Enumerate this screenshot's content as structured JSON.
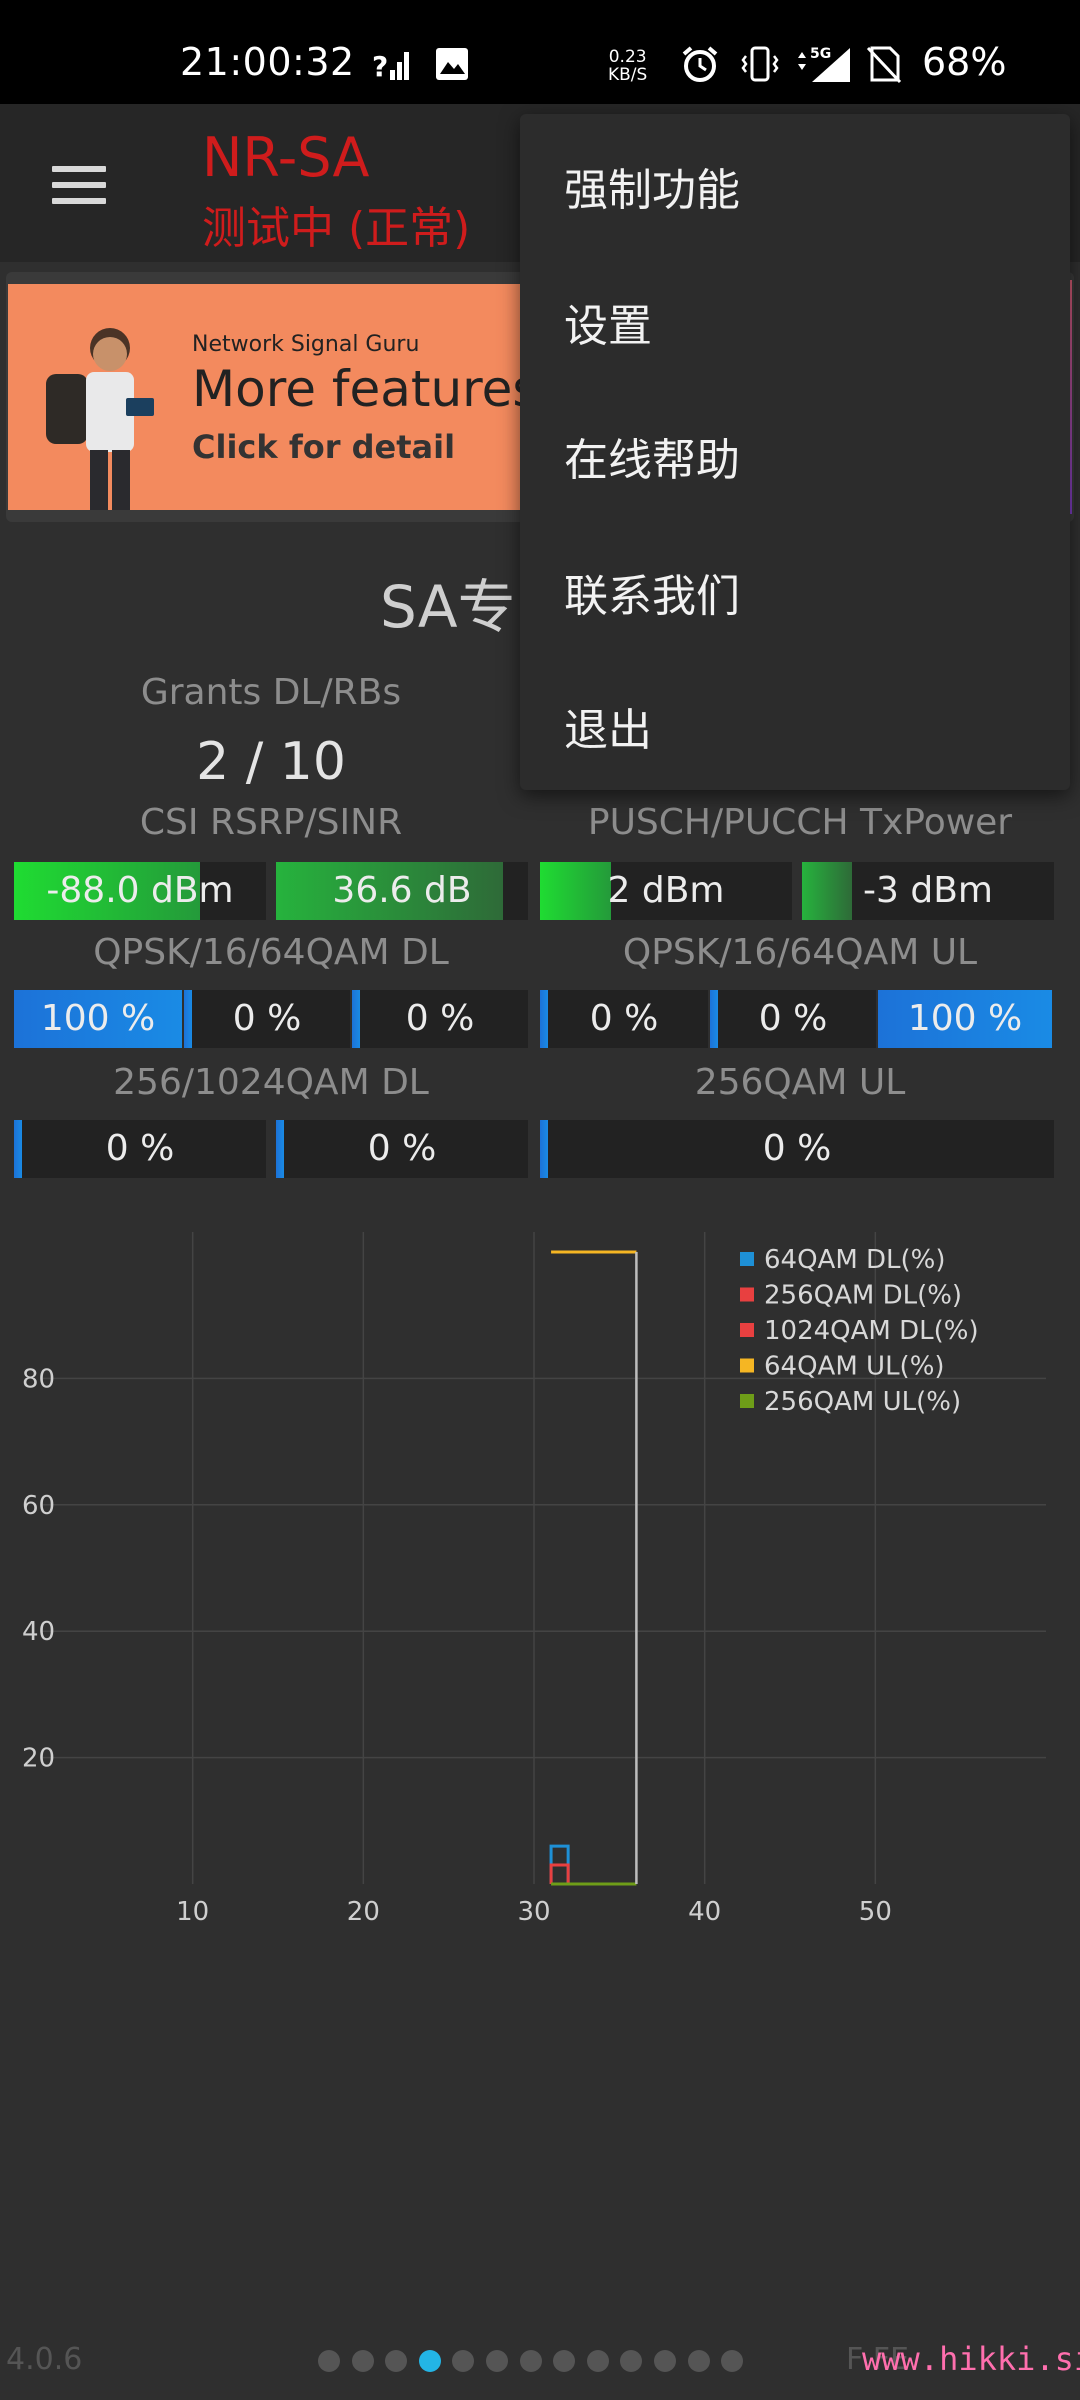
{
  "status_bar": {
    "time": "21:00:32",
    "speed_value": "0.23",
    "speed_unit": "KB/S",
    "network_badge": "5G",
    "battery": "68%",
    "icons": [
      "signal-question-icon",
      "image-icon",
      "alarm-icon",
      "vibrate-icon",
      "5g-signal-icon",
      "no-sim-icon"
    ]
  },
  "app_bar": {
    "title": "NR-SA",
    "subtitle": "测试中 (正常)"
  },
  "banner": {
    "small": "Network Signal Guru",
    "big": "More features f",
    "link": "Click for detail"
  },
  "section": {
    "title": "SA专",
    "grants_label": "Grants DL/RBs",
    "grants_value": "2 / 10",
    "csi_label": "CSI RSRP/SINR",
    "pusch_label": "PUSCH/PUCCH TxPower",
    "qam_dl_label": "QPSK/16/64QAM DL",
    "qam_ul_label": "QPSK/16/64QAM UL",
    "qam256_dl_label": "256/1024QAM DL",
    "qam256_ul_label": "256QAM UL"
  },
  "bars": {
    "csi_rsrp": {
      "text": "-88.0 dBm",
      "level": 0.74
    },
    "csi_sinr": {
      "text": "36.6 dB",
      "level": 0.9
    },
    "pusch_power": {
      "text": "2 dBm",
      "level": 0.28
    },
    "pucch_power": {
      "text": "-3 dBm",
      "level": 0.2
    },
    "dl_qpsk": {
      "text": "100 %",
      "level": 1.0
    },
    "dl_16qam": {
      "text": "0 %",
      "level": 0
    },
    "dl_64qam": {
      "text": "0 %",
      "level": 0
    },
    "ul_qpsk": {
      "text": "0 %",
      "level": 0
    },
    "ul_16qam": {
      "text": "0 %",
      "level": 0
    },
    "ul_64qam": {
      "text": "100 %",
      "level": 1.0
    },
    "dl_256qam": {
      "text": "0 %",
      "level": 0
    },
    "dl_1024qam": {
      "text": "0 %",
      "level": 0
    },
    "ul_256qam": {
      "text": "0 %",
      "level": 0
    }
  },
  "chart_data": {
    "type": "line",
    "x_ticks": [
      10,
      20,
      30,
      40,
      50
    ],
    "y_ticks": [
      20,
      40,
      60,
      80
    ],
    "xlim": [
      0,
      60
    ],
    "ylim": [
      0,
      100
    ],
    "cursor_x": 36,
    "grid": true,
    "legend_position": "top-right",
    "series": [
      {
        "name": "64QAM DL(%)",
        "color": "#1e90d6",
        "points": [
          [
            31,
            0
          ],
          [
            31,
            6
          ],
          [
            32,
            6
          ],
          [
            32,
            0
          ]
        ]
      },
      {
        "name": "256QAM DL(%)",
        "color": "#e84040",
        "points": [
          [
            31,
            0
          ],
          [
            31,
            3
          ],
          [
            32,
            3
          ],
          [
            32,
            0
          ]
        ]
      },
      {
        "name": "1024QAM DL(%)",
        "color": "#e84040",
        "points": []
      },
      {
        "name": "64QAM UL(%)",
        "color": "#f5b623",
        "points": [
          [
            31,
            100
          ],
          [
            36,
            100
          ]
        ]
      },
      {
        "name": "256QAM UL(%)",
        "color": "#6e9d18",
        "points": [
          [
            31,
            0
          ],
          [
            36,
            0
          ]
        ]
      }
    ]
  },
  "footer": {
    "version": "4.0.6",
    "right_text": "F         FE",
    "watermark": "www.hikki.site",
    "page_count": 13,
    "active_page": 3
  },
  "menu": {
    "items": [
      "强制功能",
      "设置",
      "在线帮助",
      "联系我们",
      "退出"
    ]
  }
}
